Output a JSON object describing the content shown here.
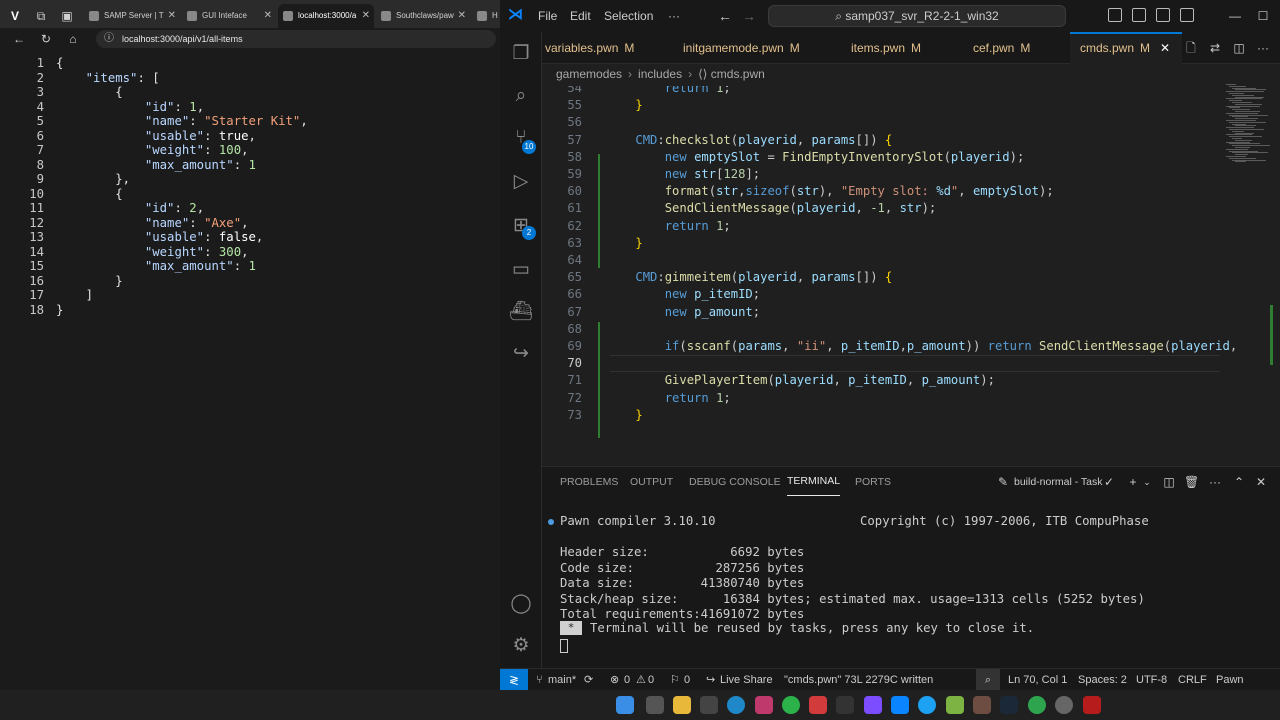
{
  "browser": {
    "tabs": [
      {
        "label": "SAMP Server | T"
      },
      {
        "label": "GUI Inteface"
      },
      {
        "label": "localhost:3000/a"
      },
      {
        "label": "Southclaws/paw"
      },
      {
        "label": "H"
      }
    ],
    "address": "localhost:3000/api/v1/all-items",
    "json_lines": [
      {
        "n": "1",
        "t": "{"
      },
      {
        "n": "2",
        "t": "    \"items\": ["
      },
      {
        "n": "3",
        "t": "        {"
      },
      {
        "n": "4",
        "t": "            \"id\": 1,"
      },
      {
        "n": "5",
        "t": "            \"name\": \"Starter Kit\","
      },
      {
        "n": "6",
        "t": "            \"usable\": true,"
      },
      {
        "n": "7",
        "t": "            \"weight\": 100,"
      },
      {
        "n": "8",
        "t": "            \"max_amount\": 1"
      },
      {
        "n": "9",
        "t": "        },"
      },
      {
        "n": "10",
        "t": "        {"
      },
      {
        "n": "11",
        "t": "            \"id\": 2,"
      },
      {
        "n": "12",
        "t": "            \"name\": \"Axe\","
      },
      {
        "n": "13",
        "t": "            \"usable\": false,"
      },
      {
        "n": "14",
        "t": "            \"weight\": 300,"
      },
      {
        "n": "15",
        "t": "            \"max_amount\": 1"
      },
      {
        "n": "16",
        "t": "        }"
      },
      {
        "n": "17",
        "t": "    ]"
      },
      {
        "n": "18",
        "t": "}"
      }
    ]
  },
  "vscode": {
    "menu": [
      "File",
      "Edit",
      "Selection",
      "···"
    ],
    "command_center": "samp037_svr_R2-2-1_win32",
    "tabs": [
      {
        "name": "variables.pwn",
        "status": "M"
      },
      {
        "name": "initgamemode.pwn",
        "status": "M"
      },
      {
        "name": "items.pwn",
        "status": "M"
      },
      {
        "name": "cef.pwn",
        "status": "M"
      },
      {
        "name": "cmds.pwn",
        "status": "M",
        "close": "✕"
      }
    ],
    "breadcrumb": [
      "gamemodes",
      "includes",
      "cmds.pwn"
    ],
    "activity_badges": {
      "scm": "10",
      "extensions": "2"
    },
    "code_lines": [
      {
        "n": "54",
        "t": "        return 1;"
      },
      {
        "n": "55",
        "t": "    }"
      },
      {
        "n": "56",
        "t": ""
      },
      {
        "n": "57",
        "t": "    CMD:checkslot(playerid, params[]) {"
      },
      {
        "n": "58",
        "t": "        new emptySlot = FindEmptyInventorySlot(playerid);"
      },
      {
        "n": "59",
        "t": "        new str[128];"
      },
      {
        "n": "60",
        "t": "        format(str,sizeof(str), \"Empty slot: %d\", emptySlot);"
      },
      {
        "n": "61",
        "t": "        SendClientMessage(playerid, -1, str);"
      },
      {
        "n": "62",
        "t": "        return 1;"
      },
      {
        "n": "63",
        "t": "    }"
      },
      {
        "n": "64",
        "t": ""
      },
      {
        "n": "65",
        "t": "    CMD:gimmeitem(playerid, params[]) {"
      },
      {
        "n": "66",
        "t": "        new p_itemID;"
      },
      {
        "n": "67",
        "t": "        new p_amount;"
      },
      {
        "n": "68",
        "t": ""
      },
      {
        "n": "69",
        "t": "        if(sscanf(params, \"ii\", p_itemID,p_amount)) return SendClientMessage(playerid,"
      },
      {
        "n": "70",
        "t": ""
      },
      {
        "n": "71",
        "t": "        GivePlayerItem(playerid, p_itemID, p_amount);"
      },
      {
        "n": "72",
        "t": "        return 1;"
      },
      {
        "n": "73",
        "t": "    }"
      }
    ],
    "panel": {
      "tabs": [
        "PROBLEMS",
        "OUTPUT",
        "DEBUG CONSOLE",
        "TERMINAL",
        "PORTS"
      ],
      "active_tab": "TERMINAL",
      "task": "build-normal - Task",
      "terminal": {
        "header_left": "Pawn compiler 3.10.10",
        "header_right": "Copyright (c) 1997-2006, ITB CompuPhase",
        "lines": [
          "Header size:           6692 bytes",
          "Code size:           287256 bytes",
          "Data size:         41380740 bytes",
          "Stack/heap size:      16384 bytes; estimated max. usage=1313 cells (5252 bytes)",
          "Total requirements:41691072 bytes"
        ],
        "star": "*",
        "reuse_message": "Terminal will be reused by tasks, press any key to close it."
      }
    },
    "statusbar": {
      "branch": "main*",
      "errors": "0",
      "warnings": "0",
      "info": "0",
      "live_share": "Live Share",
      "message": "\"cmds.pwn\" 73L 2279C written",
      "position": "Ln 70, Col 1",
      "spaces": "Spaces: 2",
      "encoding": "UTF-8",
      "eol": "CRLF",
      "language": "Pawn"
    }
  },
  "colors": {
    "accent": "#0078d4",
    "modified": "#e2c08d",
    "keyword": "#569cd6",
    "function": "#dcdcaa",
    "string": "#ce9178",
    "number": "#b5cea8"
  }
}
